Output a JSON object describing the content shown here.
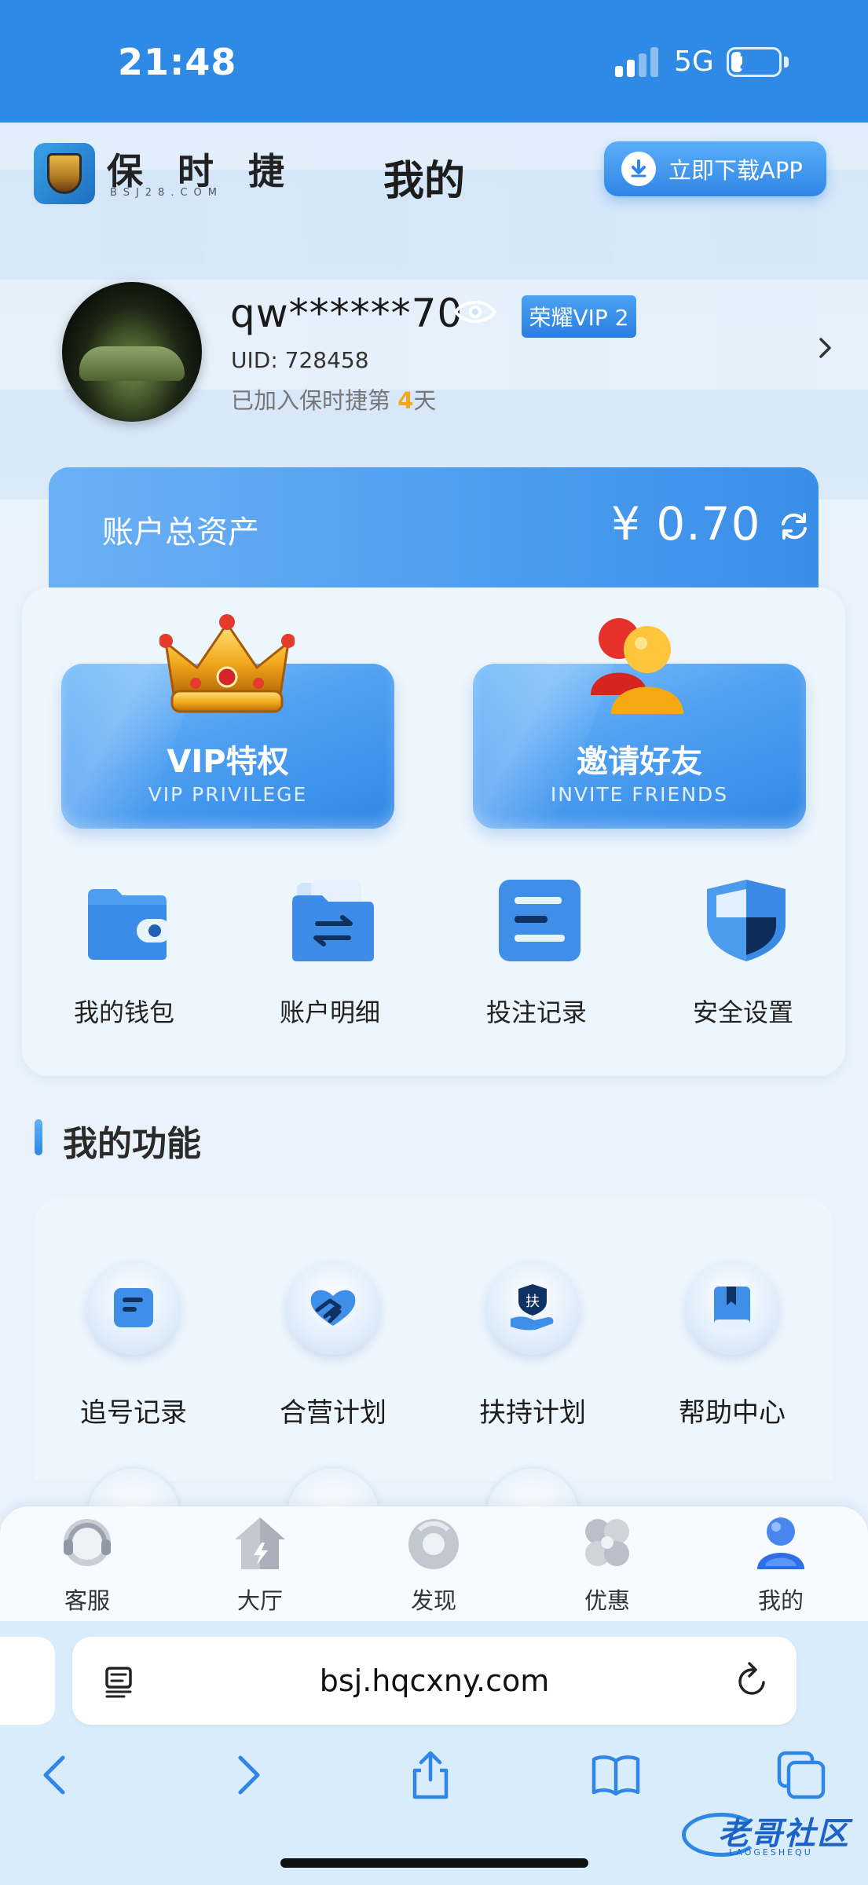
{
  "status_bar": {
    "time": "21:48",
    "network": "5G",
    "battery": "27"
  },
  "header": {
    "logo_name": "保 时 捷",
    "logo_sub": "BSJ28.COM",
    "title": "我的",
    "download_label": "立即下载APP"
  },
  "profile": {
    "username": "qw******70",
    "vip_badge": "荣耀VIP 2",
    "uid": "UID: 728458",
    "joined_prefix": "已加入保时捷第",
    "joined_days": "4",
    "joined_suffix": "天"
  },
  "assets": {
    "label": "账户总资产",
    "value": "¥ 0.70"
  },
  "promos": [
    {
      "title": "VIP特权",
      "subtitle": "VIP PRIVILEGE"
    },
    {
      "title": "邀请好友",
      "subtitle": "INVITE FRIENDS"
    }
  ],
  "quick_items": [
    {
      "label": "我的钱包",
      "icon": "wallet-icon"
    },
    {
      "label": "账户明细",
      "icon": "folder-transfer-icon"
    },
    {
      "label": "投注记录",
      "icon": "record-list-icon"
    },
    {
      "label": "安全设置",
      "icon": "shield-icon"
    }
  ],
  "functions": {
    "title": "我的功能",
    "items": [
      {
        "label": "追号记录",
        "icon": "document-icon"
      },
      {
        "label": "合营计划",
        "icon": "handshake-icon"
      },
      {
        "label": "扶持计划",
        "icon": "support-hand-icon",
        "glyph": "扶"
      },
      {
        "label": "帮助中心",
        "icon": "book-icon"
      }
    ]
  },
  "tabbar": {
    "items": [
      {
        "label": "客服",
        "icon": "headset-icon"
      },
      {
        "label": "大厅",
        "icon": "home-icon"
      },
      {
        "label": "发现",
        "icon": "compass-ring-icon"
      },
      {
        "label": "优惠",
        "icon": "clover-icon"
      },
      {
        "label": "我的",
        "icon": "user-icon",
        "active": true
      }
    ]
  },
  "browser": {
    "url": "bsj.hqcxny.com"
  },
  "watermark": {
    "text": "老哥社区",
    "sub": "LAOGESHEQU"
  },
  "colors": {
    "primary": "#2f86e6",
    "status_bar": "#2f8ae6",
    "page_bg": "#eaf3fc",
    "card_bg": "#eef6fd",
    "highlight": "#f5a623"
  }
}
